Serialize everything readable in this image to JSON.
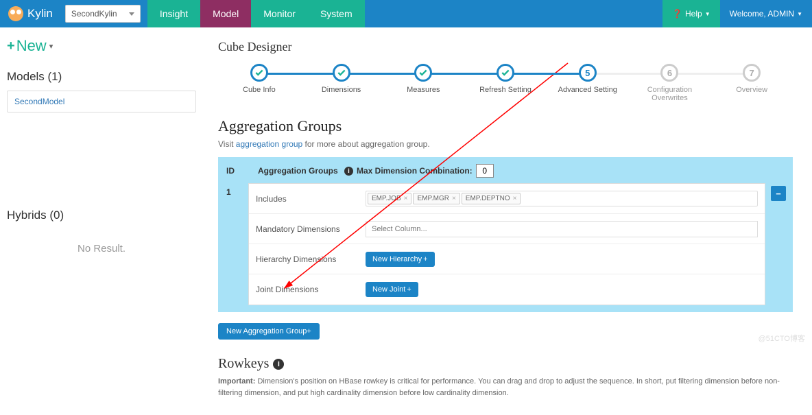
{
  "navbar": {
    "brand": "Kylin",
    "project": "SecondKylin",
    "items": [
      "Insight",
      "Model",
      "Monitor",
      "System"
    ],
    "help": "Help",
    "welcome": "Welcome, ADMIN"
  },
  "sidebar": {
    "new_label": "New",
    "models_head": "Models (1)",
    "model_item": "SecondModel",
    "hybrids_head": "Hybrids (0)",
    "no_result": "No Result."
  },
  "designer": {
    "title": "Cube Designer",
    "steps": [
      {
        "label": "Cube Info",
        "state": "done"
      },
      {
        "label": "Dimensions",
        "state": "done"
      },
      {
        "label": "Measures",
        "state": "done"
      },
      {
        "label": "Refresh Setting",
        "state": "done"
      },
      {
        "label": "Advanced Setting",
        "state": "current",
        "num": "5"
      },
      {
        "label": "Configuration Overwrites",
        "state": "future",
        "num": "6"
      },
      {
        "label": "Overview",
        "state": "future",
        "num": "7"
      }
    ]
  },
  "agg": {
    "title": "Aggregation Groups",
    "sub_pre": "Visit ",
    "sub_link": "aggregation group",
    "sub_post": " for more about aggregation group.",
    "id_header": "ID",
    "group_header": "Aggregation Groups",
    "max_label": "Max Dimension Combination:",
    "max_value": "0",
    "row_id": "1",
    "includes_label": "Includes",
    "includes_tags": [
      "EMP.JOB",
      "EMP.MGR",
      "EMP.DEPTNO"
    ],
    "mandatory_label": "Mandatory Dimensions",
    "mandatory_placeholder": "Select Column...",
    "hierarchy_label": "Hierarchy Dimensions",
    "hierarchy_btn": "New Hierarchy",
    "joint_label": "Joint Dimensions",
    "joint_btn": "New Joint",
    "remove": "−",
    "new_agg_btn": "New Aggregation Group"
  },
  "rowkeys": {
    "title": "Rowkeys",
    "important_label": "Important:",
    "desc": " Dimension's position on HBase rowkey is critical for performance. You can drag and drop to adjust the sequence. In short, put filtering dimension before non-filtering dimension, and put high cardinality dimension before low cardinality dimension."
  },
  "watermark": "@51CTO博客"
}
